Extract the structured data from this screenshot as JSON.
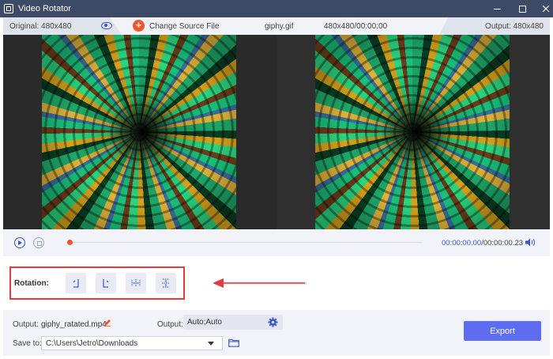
{
  "window": {
    "title": "Video Rotator"
  },
  "infobar": {
    "original_label": "Original: 480x480",
    "change_source_label": "Change Source File",
    "filename": "giphy.gif",
    "file_info": "480x480/00:00:00",
    "output_label": "Output: 480x480"
  },
  "playback": {
    "current_time": "00:00:00.00",
    "separator": "/",
    "total_time": "00:00:00.23",
    "progress_fraction": 0.0
  },
  "rotation": {
    "label": "Rotation:",
    "buttons": [
      {
        "name": "rotate-left-90",
        "icon": "rotate-left-icon"
      },
      {
        "name": "rotate-right-90",
        "icon": "rotate-right-icon"
      },
      {
        "name": "flip-horizontal",
        "icon": "flip-horizontal-icon"
      },
      {
        "name": "flip-vertical",
        "icon": "flip-vertical-icon"
      }
    ]
  },
  "output": {
    "output_label": "Output:",
    "output_filename": "giphy_ratated.mp4",
    "format_label": "Output:",
    "format_value": "Auto;Auto",
    "save_to_label": "Save to:",
    "save_path": "C:\\Users\\Jetro\\Downloads",
    "export_label": "Export"
  },
  "colors": {
    "titlebar": "#3d4a66",
    "accent": "#3a56c8",
    "orange": "#f0562a",
    "export": "#5f6df0",
    "highlight": "#e23d3d"
  }
}
